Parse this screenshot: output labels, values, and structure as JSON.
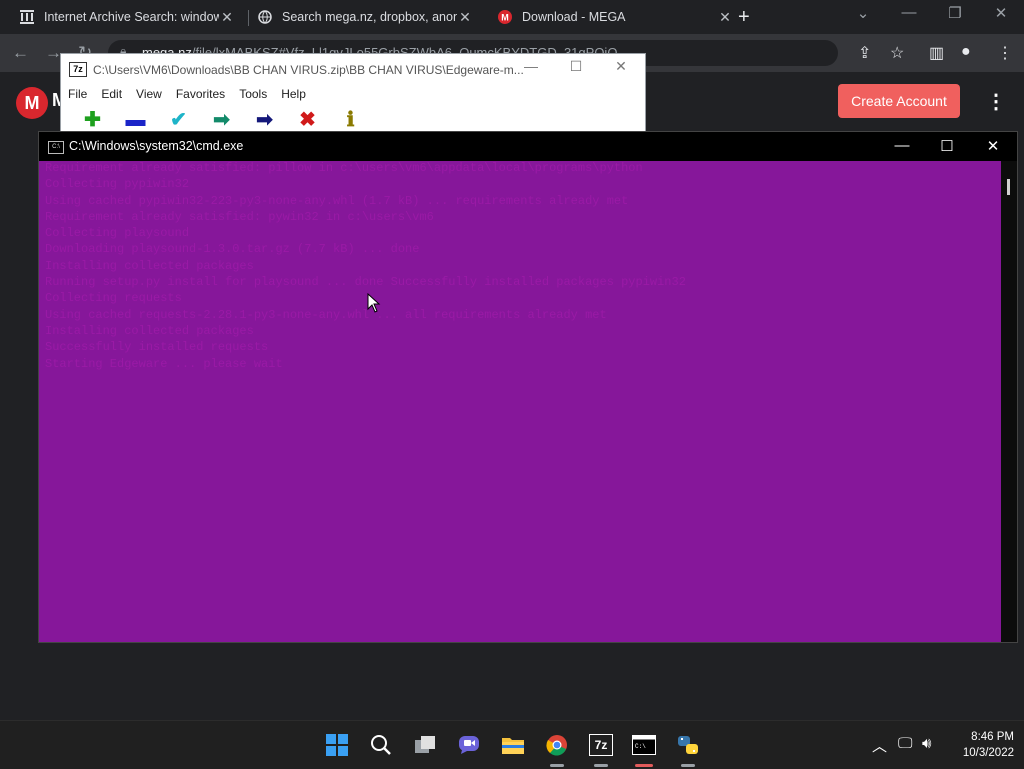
{
  "browser": {
    "tabs": [
      {
        "title": "Internet Archive Search: windows",
        "favicon": "archive-icon"
      },
      {
        "title": "Search mega.nz, dropbox, anonfi",
        "favicon": "globe-icon"
      },
      {
        "title": "Download - MEGA",
        "favicon": "mega-icon",
        "active": true
      }
    ],
    "new_tab": "+",
    "url": {
      "host": "mega.nz",
      "path": "/file/lxMABKSZ#Vfz_Ll1gvJLo55GrbSZWbA6_OumcKBYDTGD_31gPOiQ"
    }
  },
  "mega": {
    "logo_letter": "M",
    "logo_name": "M",
    "create_account": "Create Account",
    "brand_color": "#d9272e",
    "button_color": "#f0605e"
  },
  "sevenzip": {
    "title": "C:\\Users\\VM6\\Downloads\\BB CHAN VIRUS.zip\\BB CHAN VIRUS\\Edgeware-m...",
    "app_icon": "7z",
    "menu": [
      "File",
      "Edit",
      "View",
      "Favorites",
      "Tools",
      "Help"
    ],
    "tools": [
      {
        "name": "add-icon",
        "glyph": "✚",
        "color": "#1ea01e"
      },
      {
        "name": "extract-icon",
        "glyph": "▬",
        "color": "#1a24c8"
      },
      {
        "name": "test-icon",
        "glyph": "✔",
        "color": "#1eb4c8"
      },
      {
        "name": "copy-icon",
        "glyph": "➡",
        "color": "#138a6a"
      },
      {
        "name": "move-icon",
        "glyph": "➡",
        "color": "#14187a"
      },
      {
        "name": "delete-icon",
        "glyph": "✖",
        "color": "#d01a1a"
      },
      {
        "name": "info-icon",
        "glyph": "ℹ",
        "color": "#8a7a00"
      }
    ]
  },
  "cmd": {
    "title": "C:\\Windows\\system32\\cmd.exe",
    "background": "#86179a",
    "text_color": "#9a1aa6",
    "lines": [
      "Requirement already satisfied: pillow in c:\\users\\vm6\\appdata\\local\\programs\\python",
      "Collecting pypiwin32",
      "  Using cached pypiwin32-223-py3-none-any.whl (1.7 kB) ... requirements already met",
      "Requirement already satisfied: pywin32 in c:\\users\\vm6",
      "Collecting playsound",
      "  Downloading playsound-1.3.0.tar.gz (7.7 kB) ... done",
      "Installing collected packages",
      "  Running setup.py install for playsound ... done   Successfully installed packages pypiwin32",
      "Collecting requests",
      "  Using cached requests-2.28.1-py3-none-any.whl ... all requirements already met",
      "Installing collected packages",
      "Successfully installed requests",
      "Starting Edgeware ... please wait"
    ]
  },
  "taskbar": {
    "apps": [
      {
        "name": "start-icon"
      },
      {
        "name": "search-icon"
      },
      {
        "name": "task-view-icon"
      },
      {
        "name": "chat-icon"
      },
      {
        "name": "file-explorer-icon"
      },
      {
        "name": "chrome-icon"
      },
      {
        "name": "7zip-icon",
        "label": "7z"
      },
      {
        "name": "terminal-icon"
      },
      {
        "name": "python-icon"
      }
    ],
    "time": "8:46 PM",
    "date": "10/3/2022"
  }
}
